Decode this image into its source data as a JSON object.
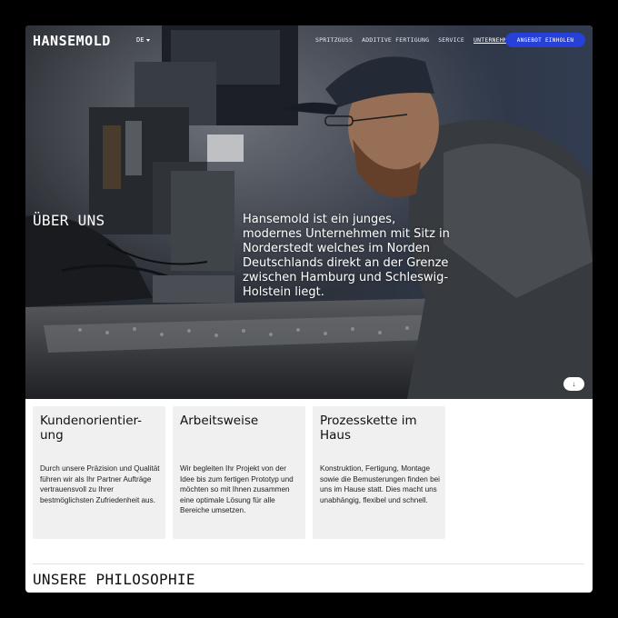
{
  "brand": {
    "logo": "HANSEMOLD",
    "accent": "#2640d8"
  },
  "language": {
    "current": "DE"
  },
  "nav": {
    "links": [
      {
        "label": "SPRITZGUSS",
        "active": false
      },
      {
        "label": "ADDITIVE FERTIGUNG",
        "active": false
      },
      {
        "label": "SERVICE",
        "active": false
      },
      {
        "label": "UNTERNEHMEN",
        "active": true
      }
    ],
    "cta_label": "ANGEBOT EINHOLEN"
  },
  "hero": {
    "title": "ÜBER UNS",
    "text": "Hansemold ist ein junges, modernes Unternehmen mit Sitz in Norderstedt welches im Norden Deutschlands direkt an der Grenze zwischen Hamburg und Schleswig-Holstein liegt.",
    "scroll_icon": "↓"
  },
  "cards": [
    {
      "title": "Kundenorientier-\nung",
      "text": "Durch unsere Präzision und Qualität führen wir als Ihr Partner Aufträge vertrauensvoll zu Ihrer bestmöglichsten Zufriedenheit aus."
    },
    {
      "title": "Arbeitsweise",
      "text": "Wir begleiten Ihr Projekt von der Idee bis zum fertigen Prototyp und möchten so mit Ihnen zusammen eine optimale Lösung für alle Bereiche umsetzen."
    },
    {
      "title": "Prozesskette im\nHaus",
      "text": "Konstruktion, Fertigung, Montage sowie die Bemusterungen finden bei uns im Hause statt. Dies macht uns unabhängig, flexibel und schnell."
    }
  ],
  "philosophy": {
    "title": "UNSERE PHILOSOPHIE"
  }
}
